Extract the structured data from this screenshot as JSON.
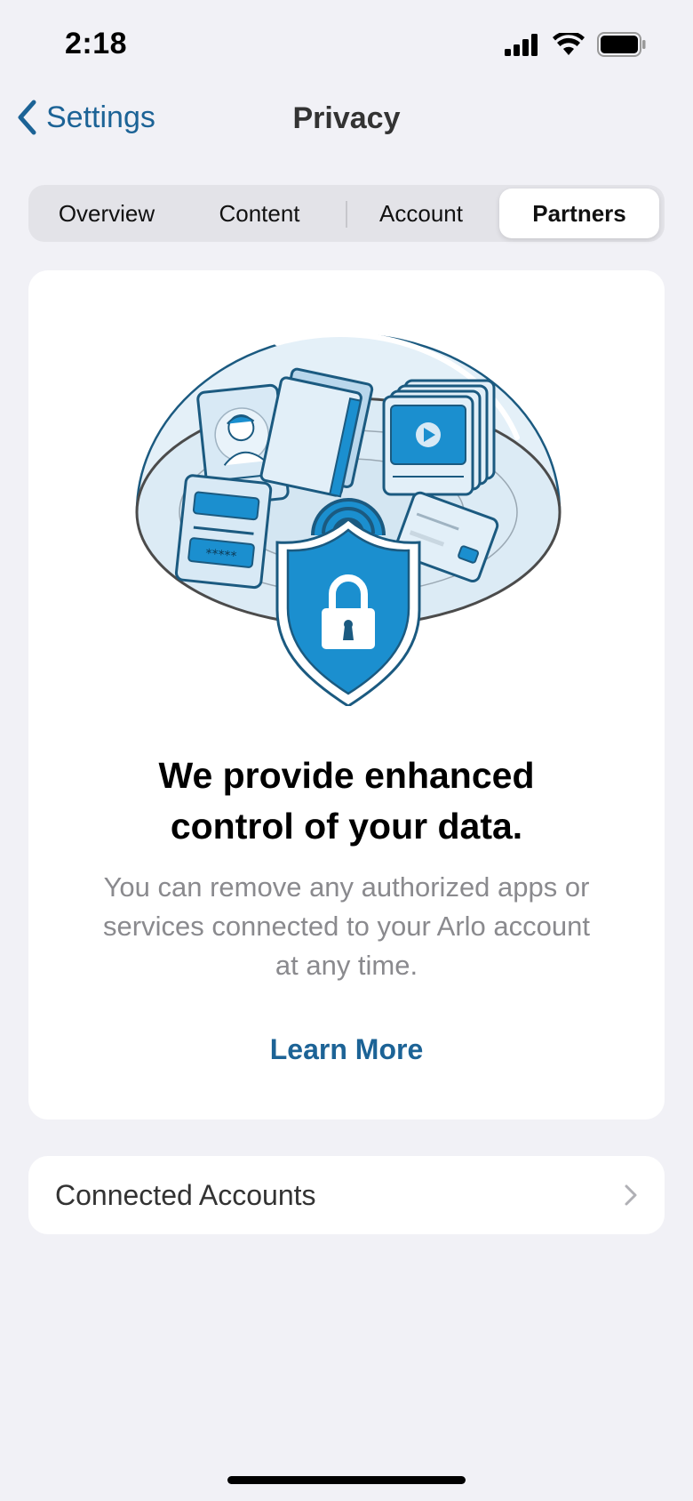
{
  "status_bar": {
    "time": "2:18",
    "icons": [
      "cellular-signal-icon",
      "wifi-icon",
      "battery-icon"
    ]
  },
  "nav": {
    "back_label": "Settings",
    "title": "Privacy"
  },
  "tabs": [
    {
      "label": "Overview",
      "active": false
    },
    {
      "label": "Content",
      "active": false
    },
    {
      "label": "Account",
      "active": false
    },
    {
      "label": "Partners",
      "active": true
    }
  ],
  "card": {
    "headline_line1": "We provide enhanced",
    "headline_line2": "control of your data.",
    "body_line1": "You can remove any authorized apps or",
    "body_line2": "services connected to your Arlo account",
    "body_line3": "at any time.",
    "link": "Learn More"
  },
  "rows": [
    {
      "label": "Connected Accounts"
    }
  ],
  "colors": {
    "accent": "#1c6396",
    "background": "#f1f1f6",
    "illustration_blue": "#1b8fcf"
  }
}
